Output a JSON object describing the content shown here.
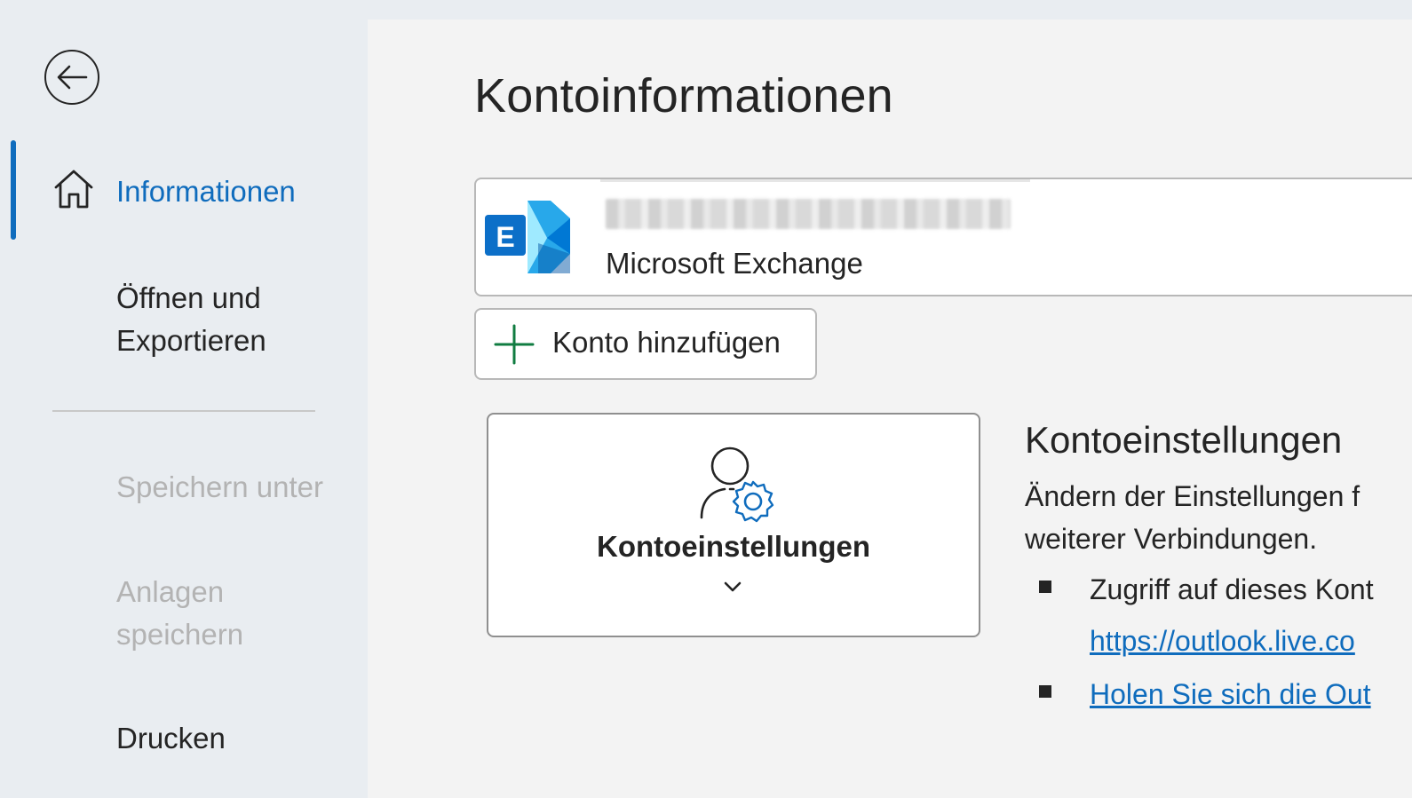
{
  "sidebar": {
    "back_label": "Zurück",
    "items": [
      {
        "label": "Informationen",
        "state": "selected"
      },
      {
        "label": "Öffnen und Exportieren",
        "state": "normal"
      },
      {
        "label": "Speichern unter",
        "state": "disabled"
      },
      {
        "label": "Anlagen speichern",
        "state": "disabled"
      },
      {
        "label": "Drucken",
        "state": "normal"
      }
    ],
    "items_lines": {
      "open_line1": "Öffnen und",
      "open_line2": "Exportieren",
      "attach_line1": "Anlagen",
      "attach_line2": "speichern"
    }
  },
  "main": {
    "title": "Kontoinformationen",
    "account": {
      "type": "Microsoft Exchange",
      "logo_letter": "E"
    },
    "add_account_label": "Konto hinzufügen",
    "settings_button_label": "Kontoeinstellungen",
    "section": {
      "title": "Kontoeinstellungen",
      "desc_line1": "Ändern der Einstellungen f",
      "desc_line2": "weiterer Verbindungen.",
      "bullet1": "Zugriff auf dieses Kont",
      "link1": "https://outlook.live.co",
      "link2": "Holen Sie sich die Out"
    }
  },
  "colors": {
    "accent": "#0f6cbd",
    "sidebar_bg": "#e9edf1",
    "main_bg": "#f3f3f3",
    "disabled_text": "#b3b3b3",
    "add_icon": "#107c41"
  },
  "icons": {
    "back": "arrow-left-circle-icon",
    "home": "home-icon",
    "add": "plus-icon",
    "settings": "user-gear-icon",
    "chevron": "chevron-down-icon",
    "exchange": "exchange-logo"
  }
}
